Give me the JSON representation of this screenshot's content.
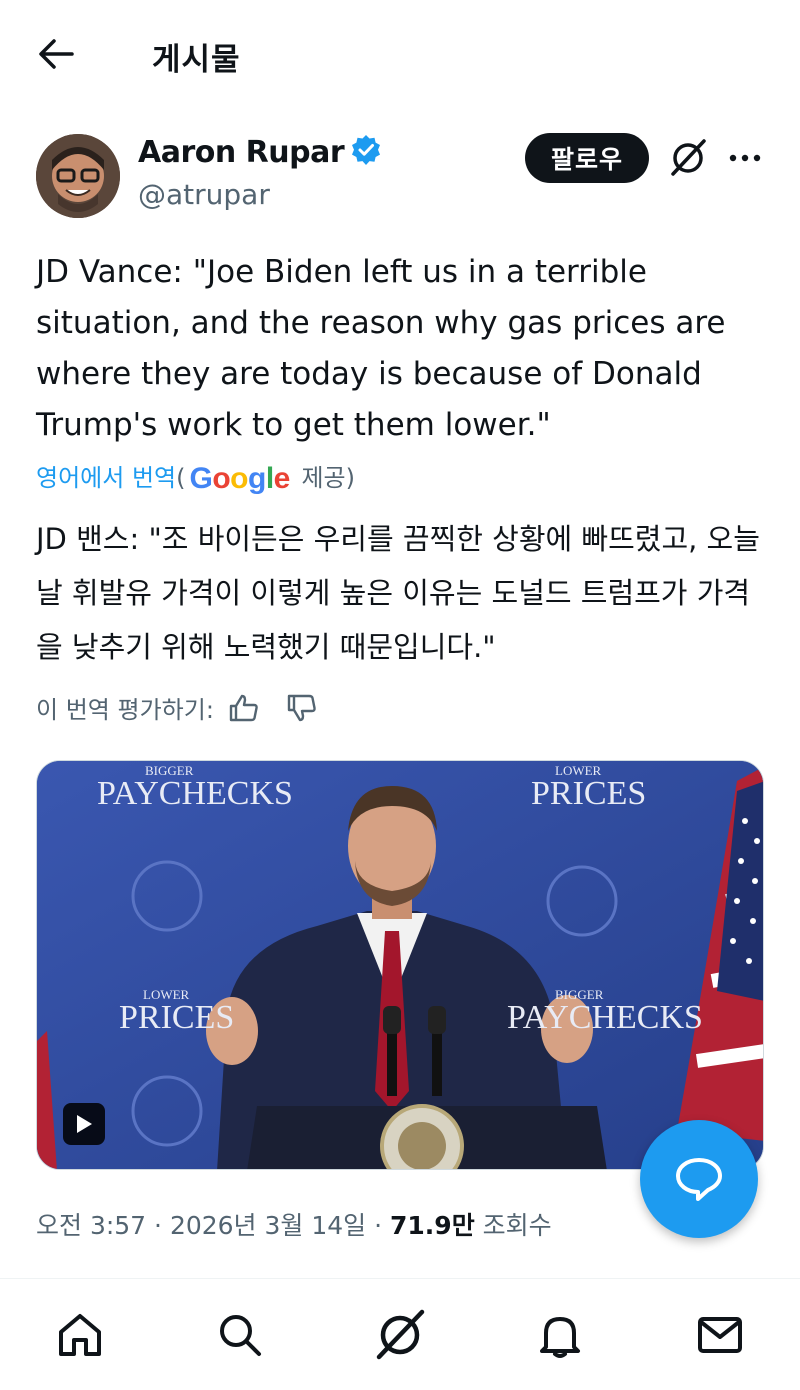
{
  "header": {
    "title": "게시물",
    "back_icon": "arrow-left-icon"
  },
  "author": {
    "display_name": "Aaron Rupar",
    "handle": "@atrupar",
    "verified": true,
    "follow_label": "팔로우",
    "grok_icon": "grok-icon",
    "more_icon": "more-horizontal-icon"
  },
  "tweet": {
    "text": "JD Vance: \"Joe Biden left us in a terrible situation, and the reason why gas prices are where they are today is because of Donald Trump's work to get them lower.\""
  },
  "translation": {
    "link_label": "영어에서 번역",
    "paren_open": "(",
    "provider": "Google",
    "provided_label": " 제공)",
    "text": "JD 밴스: \"조 바이든은 우리를 끔찍한 상황에 빠뜨렸고, 오늘날 휘발유 가격이 이렇게 높은 이유는 도널드 트럼프가 가격을 낮추기 위해 노력했기 때문입니다.\"",
    "rate_label": "이 번역 평가하기:"
  },
  "media": {
    "type": "video",
    "backdrop_texts": {
      "left_top_small": "BIGGER",
      "left_top": "PAYCHECKS",
      "right_top_small": "LOWER",
      "right_top": "PRICES",
      "left_mid_small": "LOWER",
      "left_mid": "PRICES",
      "right_mid_small": "BIGGER",
      "right_mid": "PAYCHECKS"
    }
  },
  "meta": {
    "time": "오전 3:57",
    "sep1": " · ",
    "date": "2026년 3월 14일",
    "sep2": " · ",
    "views_count": "71.9만",
    "views_label": " 조회수"
  },
  "fab": {
    "icon": "compose-reply-icon"
  },
  "nav": [
    {
      "name": "home",
      "icon": "home-icon"
    },
    {
      "name": "search",
      "icon": "search-icon"
    },
    {
      "name": "grok",
      "icon": "grok-icon"
    },
    {
      "name": "notifications",
      "icon": "bell-icon"
    },
    {
      "name": "messages",
      "icon": "mail-icon"
    }
  ],
  "colors": {
    "accent": "#1d9bf0",
    "text": "#0f1419",
    "secondary": "#536471"
  }
}
